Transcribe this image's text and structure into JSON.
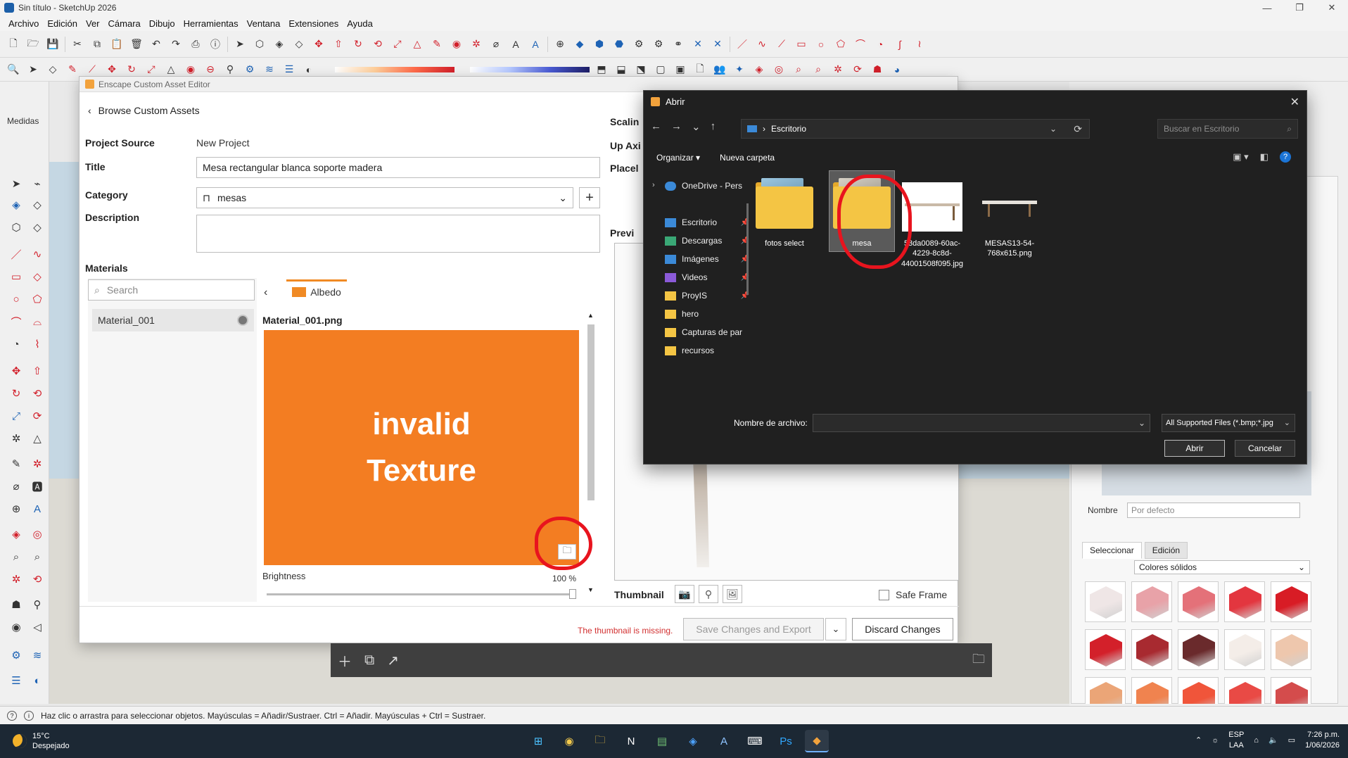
{
  "window": {
    "title": "Sin título - SketchUp 2026",
    "controls": [
      "—",
      "❐",
      "✕"
    ]
  },
  "menu": [
    "Archivo",
    "Edición",
    "Ver",
    "Cámara",
    "Dibujo",
    "Herramientas",
    "Ventana",
    "Extensiones",
    "Ayuda"
  ],
  "left_toolbar": {
    "medidas_label": "Medidas"
  },
  "enscape": {
    "window_title": "Enscape Custom Asset Editor",
    "browse_link": "Browse Custom Assets",
    "project_source_label": "Project Source",
    "project_source_value": "New Project",
    "title_label": "Title",
    "title_value": "Mesa rectangular blanca soporte madera",
    "category_label": "Category",
    "category_value": "mesas",
    "description_label": "Description",
    "description_value": "",
    "materials_label": "Materials",
    "search_placeholder": "Search",
    "materials": [
      {
        "name": "Material_001"
      }
    ],
    "albedo_tab": "Albedo",
    "texture_file": "Material_001.png",
    "texture_text_line1": "invalid",
    "texture_text_line2": "Texture",
    "brightness_label": "Brightness",
    "brightness_value": "100 %",
    "right_labels": [
      "Scalin",
      "Up Axi",
      "Placel",
      "Previ"
    ],
    "thumbnail_label": "Thumbnail",
    "safe_frame_label": "Safe Frame",
    "thumbnail_missing": "The thumbnail is missing.",
    "save_button": "Save Changes and Export",
    "discard_button": "Discard Changes",
    "accent_color": "#f37d22"
  },
  "dialog": {
    "title": "Abrir",
    "path": "Escritorio",
    "search_placeholder": "Buscar en Escritorio",
    "organize": "Organizar",
    "new_folder": "Nueva carpeta",
    "sidebar": [
      {
        "label": "OneDrive - Pers",
        "icon": "cloud-icon",
        "pinned": false
      },
      {
        "label": "Escritorio",
        "icon": "desktop-icon",
        "pinned": true
      },
      {
        "label": "Descargas",
        "icon": "download-icon",
        "pinned": true
      },
      {
        "label": "Imágenes",
        "icon": "image-icon",
        "pinned": true
      },
      {
        "label": "Videos",
        "icon": "video-icon",
        "pinned": true
      },
      {
        "label": "ProyIS",
        "icon": "folder-icon",
        "pinned": true
      },
      {
        "label": "hero",
        "icon": "folder-icon",
        "pinned": false
      },
      {
        "label": "Capturas de par",
        "icon": "folder-icon",
        "pinned": false
      },
      {
        "label": "recursos",
        "icon": "folder-icon",
        "pinned": false
      }
    ],
    "files": [
      {
        "name": "fotos select",
        "kind": "folder"
      },
      {
        "name": "mesa",
        "kind": "folder",
        "selected": true
      },
      {
        "name": "53da0089-60ac-4229-8c8d-44001508f095.jpg",
        "kind": "image"
      },
      {
        "name": "MESAS13-54-768x615.png",
        "kind": "image"
      }
    ],
    "filename_label": "Nombre de archivo:",
    "filename_value": "",
    "filter_value": "All Supported Files (*.bmp;*.jpg",
    "open_button": "Abrir",
    "cancel_button": "Cancelar"
  },
  "right_panel": {
    "name_label": "Nombre",
    "name_placeholder": "Por defecto",
    "tabs": [
      "Seleccionar",
      "Edición"
    ],
    "material_set": "Colores sólidos",
    "swatch_colors": [
      "#efe6e6",
      "#e8a2a8",
      "#e47179",
      "#e3363f",
      "#d81c25",
      "#d3202a",
      "#a82a30",
      "#6a2a2c",
      "#f4ede8",
      "#eec7ad",
      "#eba577",
      "#f0834f",
      "#f0553a",
      "#e94a45",
      "#d44c4c"
    ]
  },
  "statusbar": {
    "hint": "Haz clic o arrastra para seleccionar objetos. Mayúsculas = Añadir/Sustraer. Ctrl = Añadir. Mayúsculas + Ctrl = Sustraer."
  },
  "taskbar": {
    "temperature": "15°C",
    "weather": "Despejado",
    "language_line1": "ESP",
    "language_line2": "LAA",
    "time": "7:26 p.m.",
    "date": "1/06/2026"
  }
}
